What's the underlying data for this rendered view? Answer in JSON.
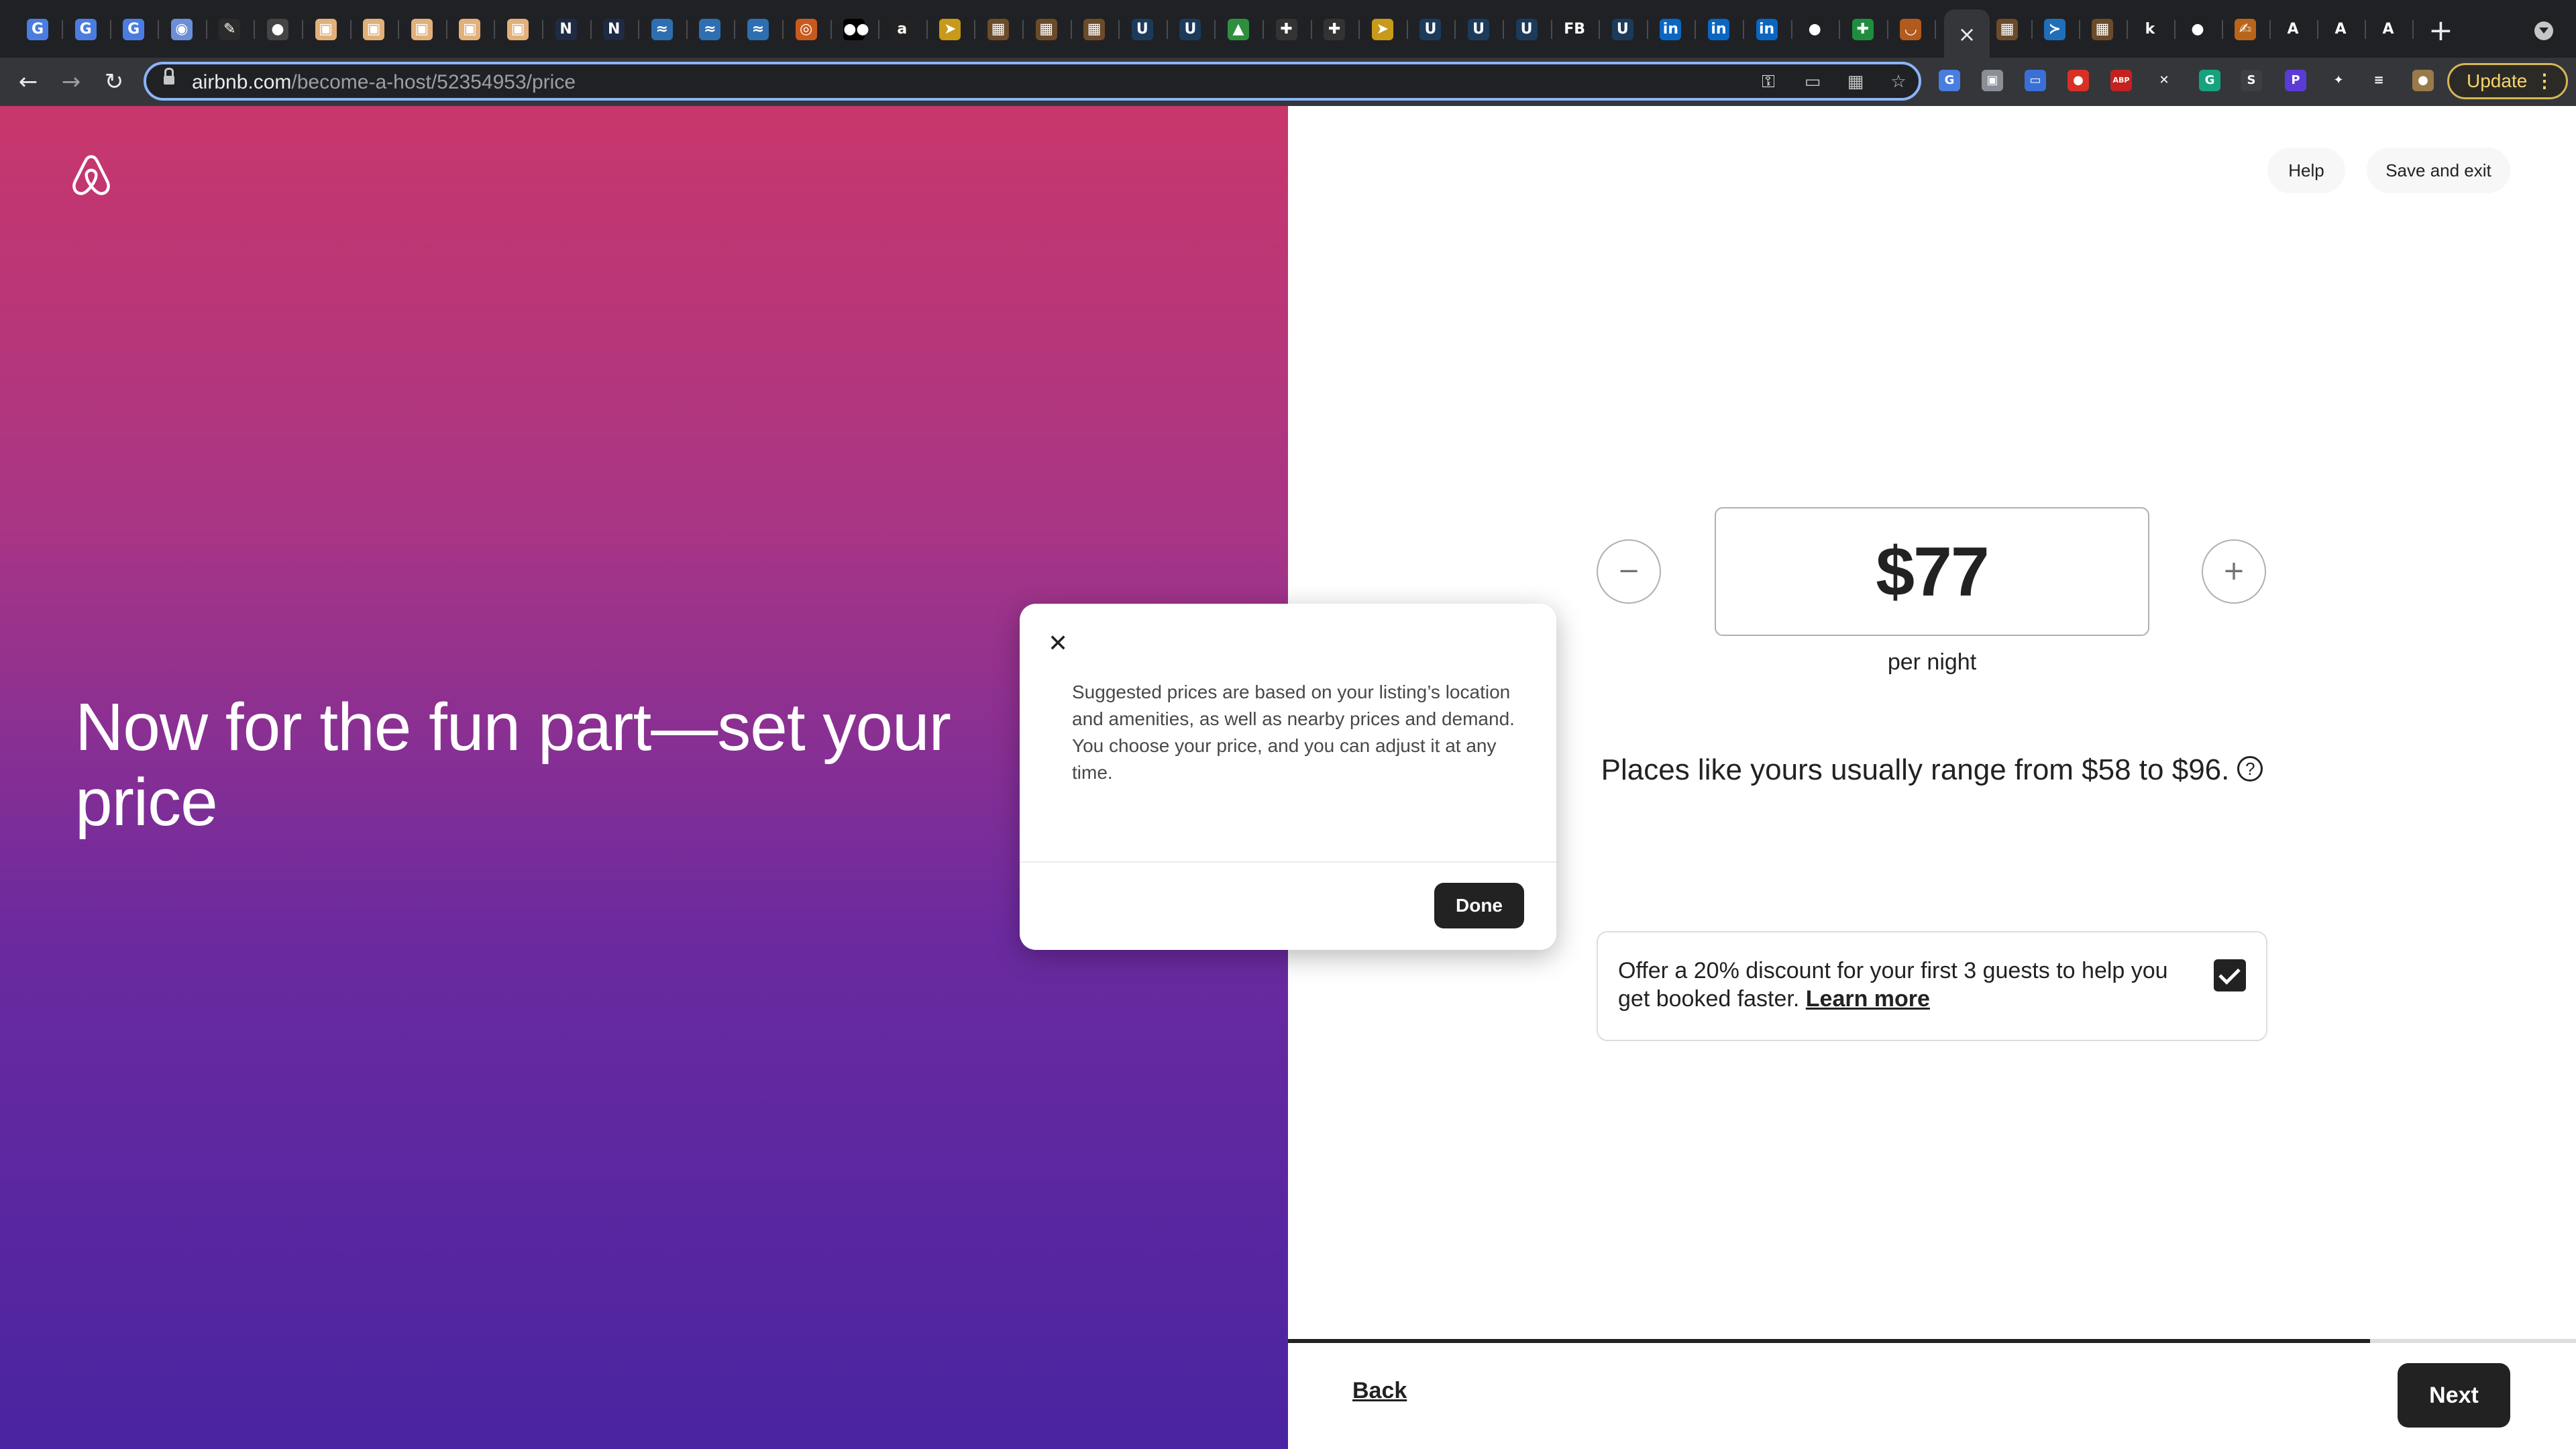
{
  "browser": {
    "url_domain": "airbnb.com",
    "url_path": "/become-a-host/52354953/price",
    "active_tab_close": "×",
    "new_tab": "+",
    "update_label": "Update",
    "update_menu": "⋮",
    "tab_favicons": [
      {
        "name": "google-translate-icon",
        "color": "#4a7de0",
        "glyph": "G"
      },
      {
        "name": "google-translate-icon",
        "color": "#4a7de0",
        "glyph": "G"
      },
      {
        "name": "google-translate-icon",
        "color": "#4a7de0",
        "glyph": "G"
      },
      {
        "name": "app-icon",
        "color": "#6b8fd6",
        "glyph": "◉"
      },
      {
        "name": "chart-icon",
        "color": "#2b2b2b",
        "glyph": "✎"
      },
      {
        "name": "globe-icon",
        "color": "#444",
        "glyph": "●"
      },
      {
        "name": "notion-page-icon",
        "color": "#e2b07a",
        "glyph": "▣"
      },
      {
        "name": "notion-page-icon",
        "color": "#e2b07a",
        "glyph": "▣"
      },
      {
        "name": "notion-page-icon",
        "color": "#e2b07a",
        "glyph": "▣"
      },
      {
        "name": "notion-page-icon",
        "color": "#e2b07a",
        "glyph": "▣"
      },
      {
        "name": "notion-page-icon",
        "color": "#e2b07a",
        "glyph": "▣"
      },
      {
        "name": "n-app-icon",
        "color": "#1f2a44",
        "glyph": "N"
      },
      {
        "name": "n-app-icon",
        "color": "#1f2a44",
        "glyph": "N"
      },
      {
        "name": "bird-icon",
        "color": "#2d6fb0",
        "glyph": "≈"
      },
      {
        "name": "bird-icon",
        "color": "#2d6fb0",
        "glyph": "≈"
      },
      {
        "name": "bird-icon",
        "color": "#2d6fb0",
        "glyph": "≈"
      },
      {
        "name": "search-orange-icon",
        "color": "#c85a1e",
        "glyph": "◎"
      },
      {
        "name": "medium-icon",
        "color": "#000",
        "glyph": "●●"
      },
      {
        "name": "amazon-icon",
        "color": "#222",
        "glyph": "a"
      },
      {
        "name": "bird-yellow-icon",
        "color": "#c79a1a",
        "glyph": "➤"
      },
      {
        "name": "photo-icon",
        "color": "#6b4b2a",
        "glyph": "▦"
      },
      {
        "name": "photo-icon",
        "color": "#6b4b2a",
        "glyph": "▦"
      },
      {
        "name": "photo-icon",
        "color": "#6b4b2a",
        "glyph": "▦"
      },
      {
        "name": "upwork-icon",
        "color": "#1c3b5a",
        "glyph": "U"
      },
      {
        "name": "upwork-icon",
        "color": "#1c3b5a",
        "glyph": "U"
      },
      {
        "name": "google-drive-icon",
        "color": "#2f8f3f",
        "glyph": "▲"
      },
      {
        "name": "plus-app-icon",
        "color": "#333",
        "glyph": "✚"
      },
      {
        "name": "plus-app-icon",
        "color": "#333",
        "glyph": "✚"
      },
      {
        "name": "bird-yellow-icon",
        "color": "#c79a1a",
        "glyph": "➤"
      },
      {
        "name": "upwork-icon",
        "color": "#1c3b5a",
        "glyph": "U"
      },
      {
        "name": "upwork-icon",
        "color": "#1c3b5a",
        "glyph": "U"
      },
      {
        "name": "upwork-icon",
        "color": "#1c3b5a",
        "glyph": "U"
      },
      {
        "name": "fb-icon",
        "color": "#202124",
        "glyph": "FB"
      },
      {
        "name": "upwork-icon",
        "color": "#1c3b5a",
        "glyph": "U"
      },
      {
        "name": "linkedin-icon",
        "color": "#0a66c2",
        "glyph": "in"
      },
      {
        "name": "linkedin-icon",
        "color": "#0a66c2",
        "glyph": "in"
      },
      {
        "name": "linkedin-icon",
        "color": "#0a66c2",
        "glyph": "in"
      },
      {
        "name": "apple-icon",
        "color": "#202124",
        "glyph": "●"
      },
      {
        "name": "google-sheets-icon",
        "color": "#1e8e3e",
        "glyph": "✚"
      },
      {
        "name": "amazon-smile-icon",
        "color": "#b35a1e",
        "glyph": "◡"
      }
    ],
    "tab_favicons_after": [
      {
        "name": "photo-icon",
        "color": "#6b4b2a",
        "glyph": "▦"
      },
      {
        "name": "vscode-icon",
        "color": "#1f6fb8",
        "glyph": "≻"
      },
      {
        "name": "photo-icon",
        "color": "#6b4b2a",
        "glyph": "▦"
      },
      {
        "name": "k-app-icon",
        "color": "#202124",
        "glyph": "k"
      },
      {
        "name": "github-icon",
        "color": "#202124",
        "glyph": "●"
      },
      {
        "name": "hand-icon",
        "color": "#b8651b",
        "glyph": "✍"
      },
      {
        "name": "airbnb-tab-icon",
        "color": "#202124",
        "glyph": "A"
      },
      {
        "name": "airbnb-tab-icon",
        "color": "#202124",
        "glyph": "A"
      },
      {
        "name": "airbnb-tab-icon",
        "color": "#202124",
        "glyph": "A"
      }
    ],
    "extensions": [
      {
        "name": "translate-ext-icon",
        "color": "#4a7de0",
        "glyph": "G"
      },
      {
        "name": "ext-box-icon",
        "color": "#8a8f96",
        "glyph": "▣"
      },
      {
        "name": "calendar-ext-icon",
        "color": "#3b6fd8",
        "glyph": "▭"
      },
      {
        "name": "red-ext-icon",
        "color": "#d93025",
        "glyph": "●"
      },
      {
        "name": "abp-ext-icon",
        "color": "#c5221f",
        "glyph": "ABP"
      },
      {
        "name": "x-ext-icon",
        "color": "#35363a",
        "glyph": "✕"
      },
      {
        "name": "grammarly-ext-icon",
        "color": "#15a37f",
        "glyph": "G"
      },
      {
        "name": "s-ext-icon",
        "color": "#3c4043",
        "glyph": "S"
      },
      {
        "name": "p-ext-icon",
        "color": "#5b3bd6",
        "glyph": "P"
      },
      {
        "name": "puzzle-ext-icon",
        "color": "#35363a",
        "glyph": "✦"
      },
      {
        "name": "reading-list-icon",
        "color": "#35363a",
        "glyph": "≡"
      },
      {
        "name": "profile-avatar-icon",
        "color": "#9a7a4a",
        "glyph": "●"
      }
    ]
  },
  "page": {
    "headline": "Now for the fun part—set your price",
    "help_label": "Help",
    "save_exit_label": "Save and exit",
    "decrement": "−",
    "increment": "+",
    "price": "$77",
    "per_night": "per night",
    "range_text": "Places like yours usually range from $58 to $96.",
    "range_help_icon": "?",
    "discount_text": "Offer a 20% discount for your first 3 guests to help you get booked faster.",
    "learn_more": "Learn more",
    "discount_checked": true,
    "progress_fraction": 0.84,
    "back_label": "Back",
    "next_label": "Next"
  },
  "modal": {
    "close": "✕",
    "text": "Suggested prices are based on your listing’s location and amenities, as well as nearby prices and demand. You choose your price, and you can adjust it at any time.",
    "done_label": "Done"
  },
  "colors": {
    "gradient_top": "#c8376c",
    "gradient_bottom": "#4a24a1",
    "primary_dark": "#222222",
    "chrome_bg": "#202124",
    "omnibox_focus": "#8ab4f8"
  }
}
